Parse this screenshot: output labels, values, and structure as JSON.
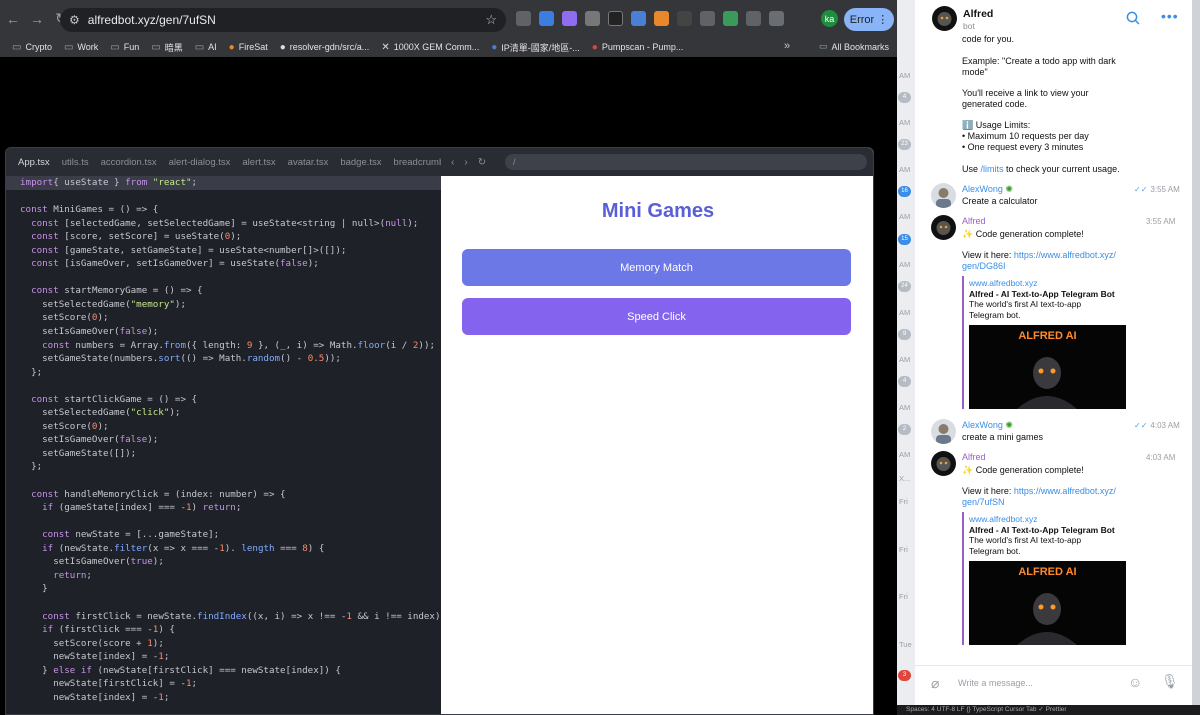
{
  "browser": {
    "url": "alfredbot.xyz/gen/7ufSN",
    "account_initials": "ka",
    "error_label": "Error",
    "bookmarks": [
      "Crypto",
      "Work",
      "Fun",
      "暗黑",
      "AI",
      "FireSat",
      "resolver-gdn/src/a...",
      "1000X GEM Comm...",
      "IP清單-國家/地區-...",
      "Pumpscan - Pump..."
    ],
    "all_bookmarks_label": "All Bookmarks"
  },
  "ide": {
    "tabs": [
      "App.tsx",
      "utils.ts",
      "accordion.tsx",
      "alert-dialog.tsx",
      "alert.tsx",
      "avatar.tsx",
      "badge.tsx",
      "breadcrumb.tsx"
    ],
    "address": "/",
    "code_lines": [
      [
        [
          "kw",
          "import"
        ],
        [
          "",
          "{ useState } "
        ],
        [
          "kw",
          "from"
        ],
        [
          "st",
          " \"react\""
        ],
        [
          "",
          ";"
        ]
      ],
      [],
      [
        [
          "kw",
          "const"
        ],
        [
          "",
          " MiniGames = () => {"
        ]
      ],
      [
        [
          "",
          "  "
        ],
        [
          "kw",
          "const"
        ],
        [
          "",
          " [selectedGame, setSelectedGame] = useState<string | null>("
        ],
        [
          "kw",
          "null"
        ],
        [
          "",
          ");"
        ]
      ],
      [
        [
          "",
          "  "
        ],
        [
          "kw",
          "const"
        ],
        [
          "",
          " [score, setScore] = useState("
        ],
        [
          "nm",
          "0"
        ],
        [
          "",
          ");"
        ]
      ],
      [
        [
          "",
          "  "
        ],
        [
          "kw",
          "const"
        ],
        [
          "",
          " [gameState, setGameState] = useState<number[]>([]);"
        ]
      ],
      [
        [
          "",
          "  "
        ],
        [
          "kw",
          "const"
        ],
        [
          "",
          " [isGameOver, setIsGameOver] = useState("
        ],
        [
          "kw",
          "false"
        ],
        [
          "",
          ");"
        ]
      ],
      [],
      [
        [
          "",
          "  "
        ],
        [
          "kw",
          "const"
        ],
        [
          "",
          " startMemoryGame = () => {"
        ]
      ],
      [
        [
          "",
          "    setSelectedGame("
        ],
        [
          "st",
          "\"memory\""
        ],
        [
          "",
          ");"
        ]
      ],
      [
        [
          "",
          "    setScore("
        ],
        [
          "nm",
          "0"
        ],
        [
          "",
          ");"
        ]
      ],
      [
        [
          "",
          "    setIsGameOver("
        ],
        [
          "kw",
          "false"
        ],
        [
          "",
          ");"
        ]
      ],
      [
        [
          "",
          "    "
        ],
        [
          "kw",
          "const"
        ],
        [
          "",
          " numbers = Array."
        ],
        [
          "fn",
          "from"
        ],
        [
          "",
          "({ length: "
        ],
        [
          "nm",
          "9"
        ],
        [
          "",
          " }, (_, i) => Math."
        ],
        [
          "fn",
          "floor"
        ],
        [
          "",
          "(i / "
        ],
        [
          "nm",
          "2"
        ],
        [
          "",
          "));"
        ]
      ],
      [
        [
          "",
          "    setGameState(numbers."
        ],
        [
          "fn",
          "sort"
        ],
        [
          "",
          "(() => Math."
        ],
        [
          "fn",
          "random"
        ],
        [
          "",
          "() - "
        ],
        [
          "nm",
          "0.5"
        ],
        [
          "",
          "));"
        ]
      ],
      [
        [
          "",
          "  };"
        ]
      ],
      [],
      [
        [
          "",
          "  "
        ],
        [
          "kw",
          "const"
        ],
        [
          "",
          " startClickGame = () => {"
        ]
      ],
      [
        [
          "",
          "    setSelectedGame("
        ],
        [
          "st",
          "\"click\""
        ],
        [
          "",
          ");"
        ]
      ],
      [
        [
          "",
          "    setScore("
        ],
        [
          "nm",
          "0"
        ],
        [
          "",
          ");"
        ]
      ],
      [
        [
          "",
          "    setIsGameOver("
        ],
        [
          "kw",
          "false"
        ],
        [
          "",
          ");"
        ]
      ],
      [
        [
          "",
          "    setGameState([]);"
        ]
      ],
      [
        [
          "",
          "  };"
        ]
      ],
      [],
      [
        [
          "",
          "  "
        ],
        [
          "kw",
          "const"
        ],
        [
          "",
          " handleMemoryClick = (index: number) => {"
        ]
      ],
      [
        [
          "",
          "    "
        ],
        [
          "kw",
          "if"
        ],
        [
          "",
          " (gameState[index] === -"
        ],
        [
          "nm",
          "1"
        ],
        [
          "",
          ") "
        ],
        [
          "kw",
          "return"
        ],
        [
          "",
          ";"
        ]
      ],
      [],
      [
        [
          "",
          "    "
        ],
        [
          "kw",
          "const"
        ],
        [
          "",
          " newState = [...gameState];"
        ]
      ],
      [
        [
          "",
          "    "
        ],
        [
          "kw",
          "if"
        ],
        [
          "",
          " (newState."
        ],
        [
          "fn",
          "filter"
        ],
        [
          "",
          "(x => x === -"
        ],
        [
          "nm",
          "1"
        ],
        [
          "",
          "). "
        ],
        [
          "fn",
          "length"
        ],
        [
          "",
          " === "
        ],
        [
          "nm",
          "8"
        ],
        [
          "",
          ") {"
        ]
      ],
      [
        [
          "",
          "      setIsGameOver("
        ],
        [
          "kw",
          "true"
        ],
        [
          "",
          ");"
        ]
      ],
      [
        [
          "",
          "      "
        ],
        [
          "kw",
          "return"
        ],
        [
          "",
          ";"
        ]
      ],
      [
        [
          "",
          "    }"
        ]
      ],
      [],
      [
        [
          "",
          "    "
        ],
        [
          "kw",
          "const"
        ],
        [
          "",
          " firstClick = newState."
        ],
        [
          "fn",
          "findIndex"
        ],
        [
          "",
          "((x, i) => x !== -"
        ],
        [
          "nm",
          "1"
        ],
        [
          "",
          " && i !== index);"
        ]
      ],
      [
        [
          "",
          "    "
        ],
        [
          "kw",
          "if"
        ],
        [
          "",
          " (firstClick === -"
        ],
        [
          "nm",
          "1"
        ],
        [
          "",
          ") {"
        ]
      ],
      [
        [
          "",
          "      setScore(score + "
        ],
        [
          "nm",
          "1"
        ],
        [
          "",
          ");"
        ]
      ],
      [
        [
          "",
          "      newState[index] = -"
        ],
        [
          "nm",
          "1"
        ],
        [
          "",
          ";"
        ]
      ],
      [
        [
          "",
          "    } "
        ],
        [
          "kw",
          "else if"
        ],
        [
          "",
          " (newState[firstClick] === newState[index]) {"
        ]
      ],
      [
        [
          "",
          "      newState[firstClick] = -"
        ],
        [
          "nm",
          "1"
        ],
        [
          "",
          ";"
        ]
      ],
      [
        [
          "",
          "      newState[index] = -"
        ],
        [
          "nm",
          "1"
        ],
        [
          "",
          ";"
        ]
      ]
    ]
  },
  "preview": {
    "title": "Mini Games",
    "memory_label": "Memory Match",
    "speed_label": "Speed Click"
  },
  "telegram": {
    "bot_name": "Alfred",
    "bot_sub": "bot",
    "intro": {
      "l1": "code for you.",
      "l2": "Example: \"Create a todo app with dark",
      "l3": "mode\"",
      "l4": "You'll receive a link to view your",
      "l5": "generated code.",
      "limits_title": "ℹ️ Usage Limits:",
      "limit1": "• Maximum 10 requests per day",
      "limit2": "• One request every 3 minutes",
      "use_pre": "Use ",
      "use_cmd": "/limits",
      "use_post": " to check your current usage."
    },
    "user_name": "AlexWong",
    "msg1": {
      "text": "Create a calculator",
      "time": "3:55 AM"
    },
    "reply1": {
      "time": "3:55 AM",
      "text": "✨ Code generation complete!",
      "view": "View it here: ",
      "link1": "https://www.alfredbot.xyz/",
      "link2": "gen/DG86I"
    },
    "msg2": {
      "text": "create a mini games",
      "time": "4:03 AM"
    },
    "reply2": {
      "time": "4:03 AM",
      "text": "✨ Code generation complete!",
      "view": "View it here: ",
      "link1": "https://www.alfredbot.xyz/",
      "link2": "gen/7ufSN"
    },
    "card": {
      "site": "www.alfredbot.xyz",
      "title": "Alfred - AI Text-to-App Telegram Bot",
      "desc1": "The world's first AI text-to-app",
      "desc2": "Telegram bot.",
      "image_title": "ALFRED AI"
    },
    "input_placeholder": "Write a message...",
    "side_badges": [
      "4",
      "23",
      "16",
      "15",
      "24",
      "9",
      "4",
      "2",
      "3"
    ],
    "side_times": [
      "AM",
      "AM",
      "AM",
      "AM",
      "AM",
      "AM",
      "AM",
      "AM",
      "AM",
      "AM",
      "X...",
      "Fri",
      "Fri",
      "Fri",
      "Tue"
    ]
  },
  "status_bar": "Spaces: 4    UTF-8    LF    {} TypeScript    Cursor Tab    ✓ Prettier"
}
